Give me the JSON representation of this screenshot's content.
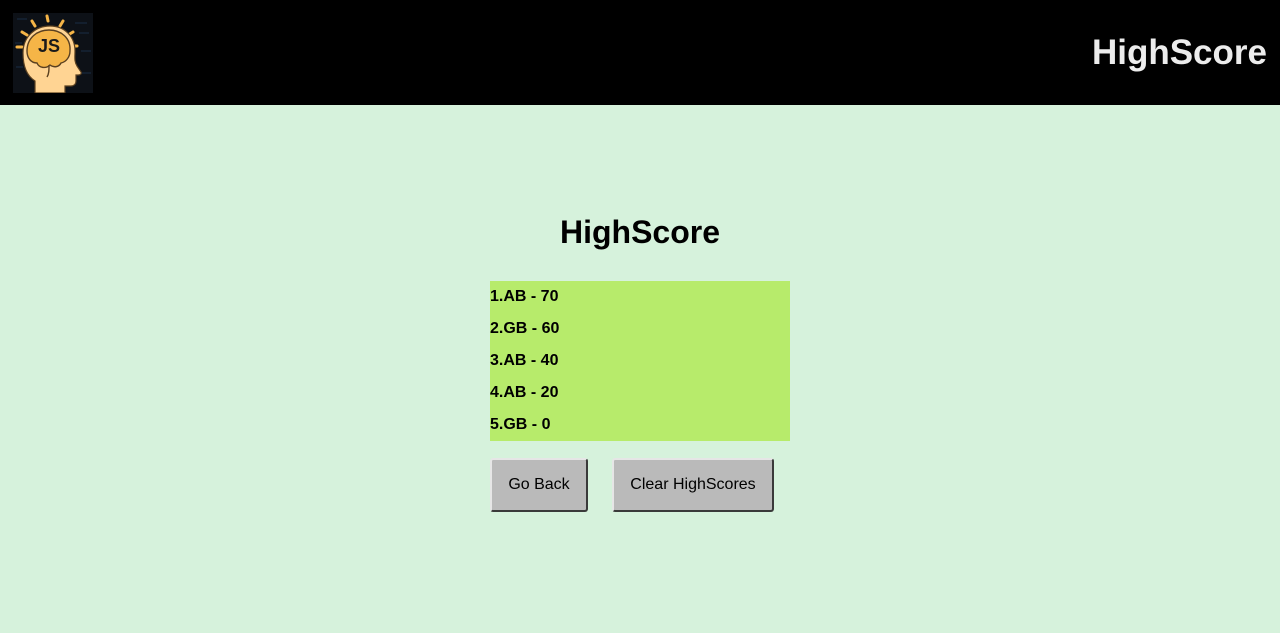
{
  "header": {
    "logo_icon": "js-brain-logo-icon",
    "logo_text": "JS",
    "title": "HighScore"
  },
  "main": {
    "title": "HighScore",
    "scores": [
      "1.AB - 70",
      "2.GB - 60",
      "3.AB - 40",
      "4.AB - 20",
      "5.GB - 0"
    ],
    "buttons": {
      "back_label": "Go Back",
      "clear_label": "Clear HighScores"
    }
  },
  "colors": {
    "header_bg": "#000000",
    "page_bg": "#d6f2dc",
    "list_bg": "#b7eb6b",
    "button_bg": "#bababa",
    "logo_head": "#ffd493",
    "logo_brain": "#f5b547"
  }
}
